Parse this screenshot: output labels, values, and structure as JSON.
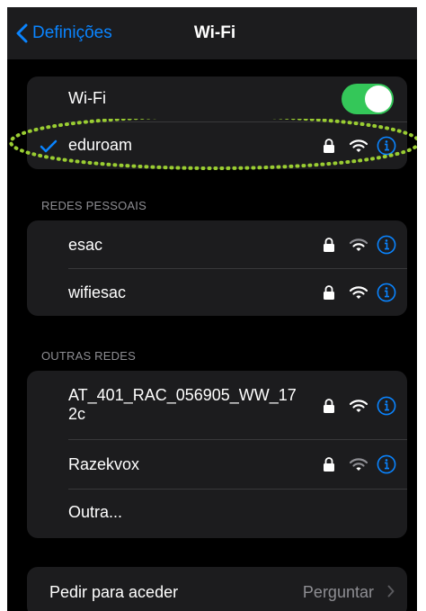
{
  "navbar": {
    "back_label": "Definições",
    "title": "Wi-Fi"
  },
  "wifi_group": {
    "toggle_label": "Wi-Fi",
    "toggle_on": true,
    "connected_network": "eduroam"
  },
  "personal": {
    "header": "REDES PESSOAIS",
    "networks": [
      {
        "name": "esac"
      },
      {
        "name": "wifiesac"
      }
    ]
  },
  "other": {
    "header": "OUTRAS REDES",
    "networks": [
      {
        "name_line1": "AT_401_RAC_056905_WW_17",
        "name_line2": "2c"
      },
      {
        "name": "Razekvox"
      }
    ],
    "other_label": "Outra..."
  },
  "ask_to_join": {
    "label": "Pedir para aceder",
    "value": "Perguntar"
  },
  "colors": {
    "accent": "#0a84ff",
    "toggle_on": "#34c759",
    "annotation": "#9acd32",
    "cell_bg": "#1c1c1e"
  },
  "icons": [
    "chevron-left-icon",
    "checkmark-icon",
    "lock-icon",
    "wifi-icon",
    "info-icon",
    "chevron-right-icon"
  ]
}
